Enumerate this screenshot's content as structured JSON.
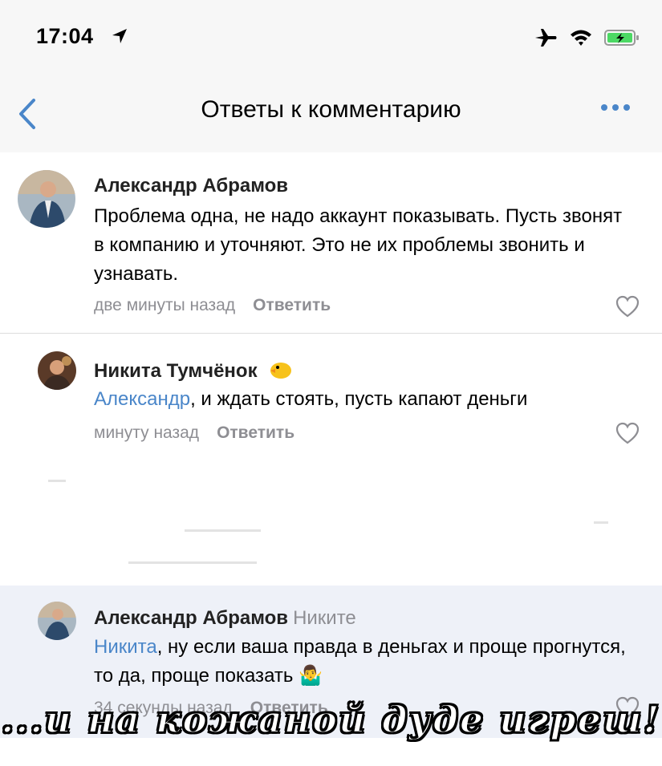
{
  "status": {
    "time": "17:04"
  },
  "nav": {
    "title": "Ответы к комментарию"
  },
  "comments": [
    {
      "author": "Александр Абрамов",
      "text": "Проблема одна, не надо аккаунт показывать. Пусть звонят в компанию и уточняют. Это не их проблемы звонить и узнавать.",
      "time": "две минуты назад",
      "reply": "Ответить"
    },
    {
      "author": "Никита Тумчёнок",
      "author_emoji": "🐤",
      "mention": "Александр",
      "text": ", и ждать стоять, пусть капают деньги",
      "time": "минуту назад",
      "reply": "Ответить"
    },
    {
      "author": "Александр Абрамов",
      "to": "Никите",
      "mention": "Никита",
      "text": ", ну если ваша правда в деньгах и проще прогнутся, то да, проще показать 🤷‍♂️",
      "time": "34 секунды назад",
      "reply": "Ответить"
    }
  ],
  "caption": "...и на кожаной дуде игреш!",
  "colors": {
    "accent": "#4a86c9",
    "highlight": "#eef1f8",
    "secondary": "#8e8e93"
  }
}
